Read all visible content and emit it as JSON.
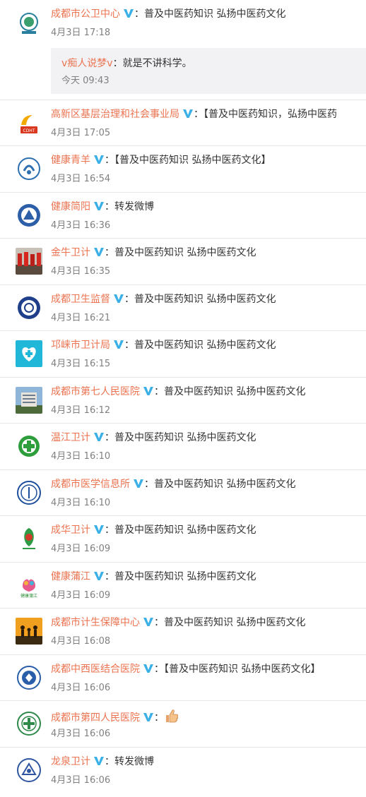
{
  "colors": {
    "name": "#eb7350",
    "verified": "#3bb0e6",
    "time": "#808080",
    "text": "#333333"
  },
  "comments": [
    {
      "name": "成都市公卫中心",
      "text": "普及中医药知识  弘扬中医药文化",
      "time": "4月3日 17:18",
      "reply": {
        "name": "v痴人说梦v",
        "text": "就是不讲科学。",
        "time": "今天 09:43"
      }
    },
    {
      "name": "高新区基层治理和社会事业局",
      "text": "【普及中医药知识，弘扬中医药",
      "time": "4月3日 17:05",
      "avatar_text": "成都高新 CDHT"
    },
    {
      "name": "健康青羊",
      "text": "【普及中医药知识  弘扬中医药文化】",
      "time": "4月3日 16:54"
    },
    {
      "name": "健康简阳",
      "text": "转发微博",
      "time": "4月3日 16:36"
    },
    {
      "name": "金牛卫计",
      "text": "普及中医药知识  弘扬中医药文化",
      "time": "4月3日 16:35"
    },
    {
      "name": "成都卫生监督",
      "text": "普及中医药知识  弘扬中医药文化",
      "time": "4月3日 16:21"
    },
    {
      "name": "邛崃市卫计局",
      "text": "普及中医药知识  弘扬中医药文化",
      "time": "4月3日 16:15"
    },
    {
      "name": "成都市第七人民医院",
      "text": "普及中医药知识  弘扬中医药文化",
      "time": "4月3日 16:12"
    },
    {
      "name": "温江卫计",
      "text": "普及中医药知识  弘扬中医药文化",
      "time": "4月3日 16:10"
    },
    {
      "name": "成都市医学信息所",
      "text": "普及中医药知识  弘扬中医药文化",
      "time": "4月3日 16:10"
    },
    {
      "name": "成华卫计",
      "text": "普及中医药知识  弘扬中医药文化",
      "time": "4月3日 16:09"
    },
    {
      "name": "健康蒲江",
      "text": "普及中医药知识  弘扬中医药文化",
      "time": "4月3日 16:09",
      "avatar_text": "健康蒲江"
    },
    {
      "name": "成都市计生保障中心",
      "text": "普及中医药知识  弘扬中医药文化",
      "time": "4月3日 16:08"
    },
    {
      "name": "成都中西医结合医院",
      "text": "【普及中医药知识  弘扬中医药文化】",
      "time": "4月3日 16:06"
    },
    {
      "name": "成都市第四人民医院",
      "text": "",
      "emoji": "thumbs-up-icon",
      "time": "4月3日 16:06"
    },
    {
      "name": "龙泉卫计",
      "text": "转发微博",
      "time": "4月3日 16:06"
    }
  ]
}
